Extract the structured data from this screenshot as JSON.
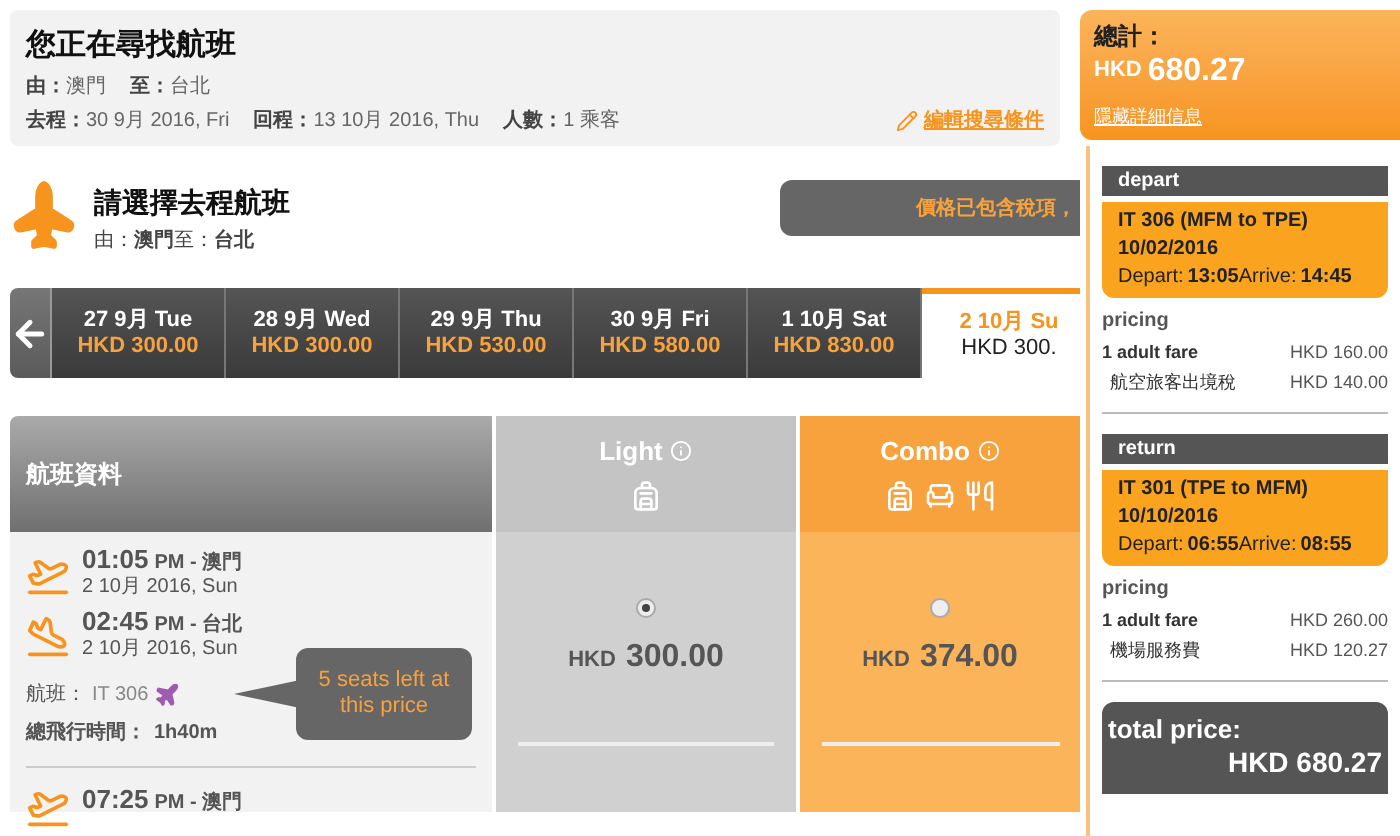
{
  "search_summary": {
    "title": "您正在尋找航班",
    "from_label": "由：",
    "from": "澳門",
    "to_label": "至：",
    "to": "台北",
    "depart_label": "去程：",
    "depart": "30 9月 2016, Fri",
    "return_label": "回程：",
    "return": "13 10月 2016, Thu",
    "pax_label": "人數：",
    "pax": "1 乘客",
    "edit_link": "編輯搜尋條件"
  },
  "section": {
    "title": "請選擇去程航班",
    "from_label": "由：",
    "from": "澳門",
    "to_label": "至：",
    "to": "台北",
    "notice": "價格已包含稅項，"
  },
  "date_tabs": [
    {
      "date": "27 9月 Tue",
      "price": "HKD 300.00",
      "selected": false
    },
    {
      "date": "28 9月 Wed",
      "price": "HKD 300.00",
      "selected": false
    },
    {
      "date": "29 9月 Thu",
      "price": "HKD 530.00",
      "selected": false
    },
    {
      "date": "30 9月 Fri",
      "price": "HKD 580.00",
      "selected": false
    },
    {
      "date": "1 10月 Sat",
      "price": "HKD 830.00",
      "selected": false
    },
    {
      "date": "2 10月 Su",
      "price": "HKD 300.",
      "selected": true
    }
  ],
  "table": {
    "info_header": "航班資料",
    "fares": [
      {
        "kind": "light",
        "name": "Light"
      },
      {
        "kind": "combo",
        "name": "Combo"
      }
    ]
  },
  "flights": [
    {
      "depart_time": "01:05",
      "depart_detail": "PM - 澳門",
      "depart_date": "2 10月 2016, Sun",
      "arrive_time": "02:45",
      "arrive_detail": "PM - 台北",
      "arrive_date": "2 10月 2016, Sun",
      "flight_label": "航班：",
      "flight_no": "IT 306",
      "duration_label": "總飛行時間：",
      "duration": "1h40m",
      "seats_note": "5 seats left at this price",
      "prices": [
        {
          "currency": "HKD",
          "amount": "300.00",
          "selected": true
        },
        {
          "currency": "HKD",
          "amount": "374.00",
          "selected": false
        }
      ]
    },
    {
      "depart_time": "07:25",
      "depart_detail": "PM - 澳門"
    }
  ],
  "summary": {
    "label": "總計：",
    "currency": "HKD",
    "amount": "680.27",
    "toggle_link": "隱藏詳細信息",
    "legs": [
      {
        "heading": "depart",
        "flight": "IT 306 (MFM to TPE)",
        "date": "10/02/2016",
        "depart_label": "Depart:",
        "depart_time": "13:05",
        "arrive_label": "Arrive:",
        "arrive_time": "14:45",
        "pricing_label": "pricing",
        "lines": [
          {
            "label": "1 adult fare",
            "amount": "HKD 160.00"
          },
          {
            "label": "航空旅客出境稅",
            "amount": "HKD 140.00"
          }
        ]
      },
      {
        "heading": "return",
        "flight": "IT 301 (TPE to MFM)",
        "date": "10/10/2016",
        "depart_label": "Depart:",
        "depart_time": "06:55",
        "arrive_label": "Arrive:",
        "arrive_time": "08:55",
        "pricing_label": "pricing",
        "lines": [
          {
            "label": "1 adult fare",
            "amount": "HKD 260.00"
          },
          {
            "label": "機場服務費",
            "amount": "HKD 120.27"
          }
        ]
      }
    ],
    "total_label": "total price:",
    "total": "HKD 680.27"
  }
}
